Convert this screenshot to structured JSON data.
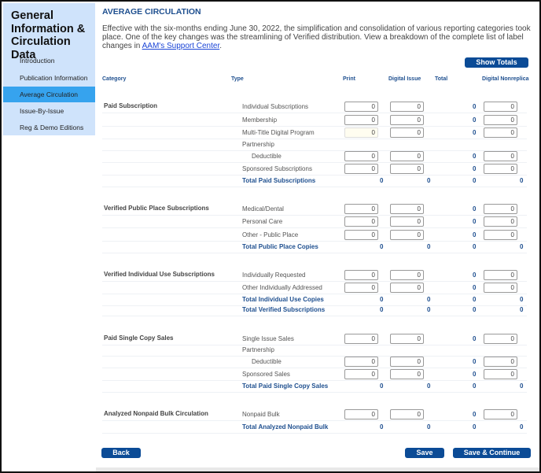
{
  "sidebar": {
    "title": "General Information & Circulation Data",
    "items": [
      {
        "label": "Introduction",
        "active": false
      },
      {
        "label": "Publication Information",
        "active": false
      },
      {
        "label": "Average Circulation",
        "active": true
      },
      {
        "label": "Issue-By-Issue",
        "active": false
      },
      {
        "label": "Reg & Demo Editions",
        "active": false
      }
    ]
  },
  "main": {
    "heading": "AVERAGE CIRCULATION",
    "intro": "Effective with the six-months ending June 30, 2022, the simplification and consolidation of various reporting categories took place. One of the key changes was the streamlining of Verified distribution. View a breakdown of the complete list of label changes in ",
    "intro_link": "AAM's Support Center",
    "intro_end": ".",
    "show_totals": "Show Totals",
    "columns": {
      "category": "Category",
      "type": "Type",
      "print": "Print",
      "digital_issue": "Digital Issue",
      "total": "Total",
      "digital_nonreplica": "Digital Nonreplica"
    },
    "rows": [
      {
        "category": "Paid Subscription",
        "type": "Individual Subscriptions",
        "kind": "input",
        "print": "0",
        "digital": "0",
        "total": "0",
        "nonreplica": "0"
      },
      {
        "type": "Membership",
        "kind": "input",
        "print": "0",
        "digital": "0",
        "total": "0",
        "nonreplica": "0"
      },
      {
        "type": "Multi-Title Digital Program",
        "kind": "input",
        "print": "0",
        "digital": "0",
        "total": "0",
        "nonreplica": "0",
        "highlight": true
      },
      {
        "type": "Partnership",
        "kind": "label"
      },
      {
        "type": "Deductible",
        "kind": "input",
        "indent": true,
        "print": "0",
        "digital": "0",
        "total": "0",
        "nonreplica": "0"
      },
      {
        "type": "Sponsored Subscriptions",
        "kind": "input",
        "print": "0",
        "digital": "0",
        "total": "0",
        "nonreplica": "0"
      },
      {
        "type": "Total Paid Subscriptions",
        "kind": "total",
        "print": "0",
        "digital": "0",
        "total": "0",
        "nonreplica": "0"
      },
      {
        "category": "Verified Public Place Subscriptions",
        "type": "Medical/Dental",
        "kind": "input",
        "print": "0",
        "digital": "0",
        "total": "0",
        "nonreplica": "0"
      },
      {
        "type": "Personal Care",
        "kind": "input",
        "print": "0",
        "digital": "0",
        "total": "0",
        "nonreplica": "0"
      },
      {
        "type": "Other - Public Place",
        "kind": "input",
        "print": "0",
        "digital": "0",
        "total": "0",
        "nonreplica": "0"
      },
      {
        "type": "Total Public Place Copies",
        "kind": "total",
        "print": "0",
        "digital": "0",
        "total": "0",
        "nonreplica": "0"
      },
      {
        "category": "Verified Individual Use Subscriptions",
        "type": "Individually Requested",
        "kind": "input",
        "print": "0",
        "digital": "0",
        "total": "0",
        "nonreplica": "0"
      },
      {
        "type": "Other Individually Addressed",
        "kind": "input",
        "print": "0",
        "digital": "0",
        "total": "0",
        "nonreplica": "0"
      },
      {
        "type": "Total Individual Use Copies",
        "kind": "total",
        "print": "0",
        "digital": "0",
        "total": "0",
        "nonreplica": "0"
      },
      {
        "type": "Total Verified Subscriptions",
        "kind": "total",
        "print": "0",
        "digital": "0",
        "total": "0",
        "nonreplica": "0"
      },
      {
        "category": "Paid Single Copy Sales",
        "type": "Single Issue Sales",
        "kind": "input",
        "print": "0",
        "digital": "0",
        "total": "0",
        "nonreplica": "0"
      },
      {
        "type": "Partnership",
        "kind": "label"
      },
      {
        "type": "Deductible",
        "kind": "input",
        "indent": true,
        "print": "0",
        "digital": "0",
        "total": "0",
        "nonreplica": "0"
      },
      {
        "type": "Sponsored Sales",
        "kind": "input",
        "print": "0",
        "digital": "0",
        "total": "0",
        "nonreplica": "0"
      },
      {
        "type": "Total Paid Single Copy Sales",
        "kind": "total",
        "print": "0",
        "digital": "0",
        "total": "0",
        "nonreplica": "0"
      },
      {
        "category": "Analyzed Nonpaid Bulk Circulation",
        "type": "Nonpaid Bulk",
        "kind": "input",
        "print": "0",
        "digital": "0",
        "total": "0",
        "nonreplica": "0"
      },
      {
        "type": "Total Analyzed Nonpaid Bulk",
        "kind": "total",
        "print": "0",
        "digital": "0",
        "total": "0",
        "nonreplica": "0"
      }
    ],
    "buttons": {
      "back": "Back",
      "save": "Save",
      "save_continue": "Save & Continue"
    }
  },
  "colors": {
    "accent": "#0b4b96",
    "sidebar_bg": "#cfe3fb",
    "sidebar_active": "#36a3ee",
    "heading": "#1e4f8f"
  }
}
